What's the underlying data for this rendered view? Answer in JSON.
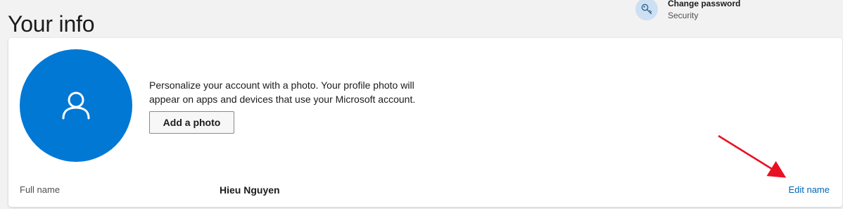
{
  "page": {
    "title": "Your info"
  },
  "shortcut": {
    "title": "Change password",
    "subtitle": "Security",
    "icon": "key-icon"
  },
  "profile": {
    "description": "Personalize your account with a photo. Your profile photo will appear on apps and devices that use your Microsoft account.",
    "add_photo_label": "Add a photo",
    "avatar_icon": "person-icon",
    "avatar_color": "#0078d4"
  },
  "name_row": {
    "label": "Full name",
    "value": "Hieu Nguyen",
    "action_label": "Edit name"
  },
  "colors": {
    "accent": "#0078d4",
    "link": "#0067b8",
    "annotation": "#e81123"
  }
}
